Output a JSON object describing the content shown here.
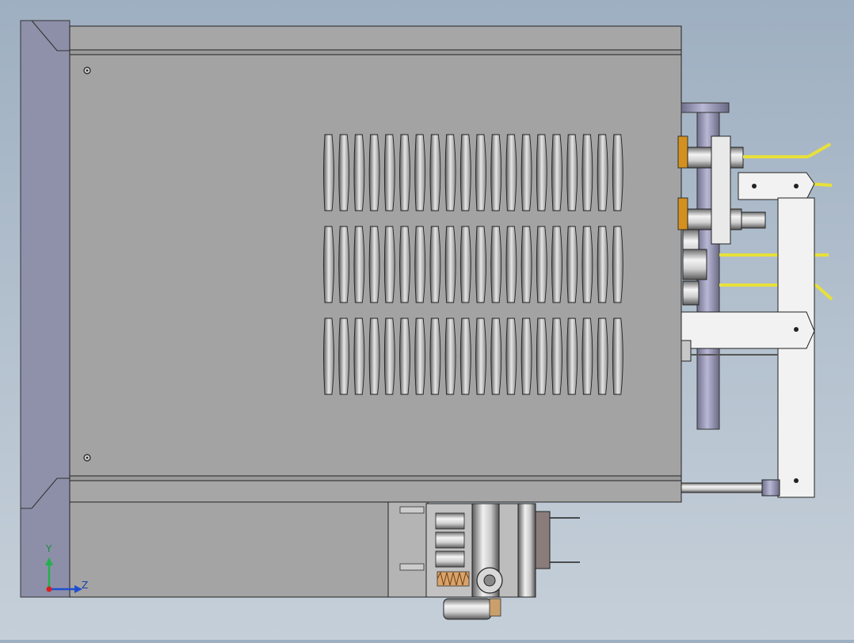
{
  "viewport": {
    "background_top": "#9eafc1",
    "background_bottom": "#c5cfd9"
  },
  "model": {
    "housing_color": "#a3a3a3",
    "flange_color": "#8d8fa8",
    "slot_rows": 3,
    "slots_per_row": 20,
    "wire_color": "#e8e03a",
    "bracket_color": "#f2f2f2",
    "terminal_color": "#d4901f"
  },
  "triad": {
    "y_label": "Y",
    "z_label": "Z",
    "y_color": "#22b14c",
    "z_color": "#1f4fd0",
    "origin_color": "#d42020"
  }
}
